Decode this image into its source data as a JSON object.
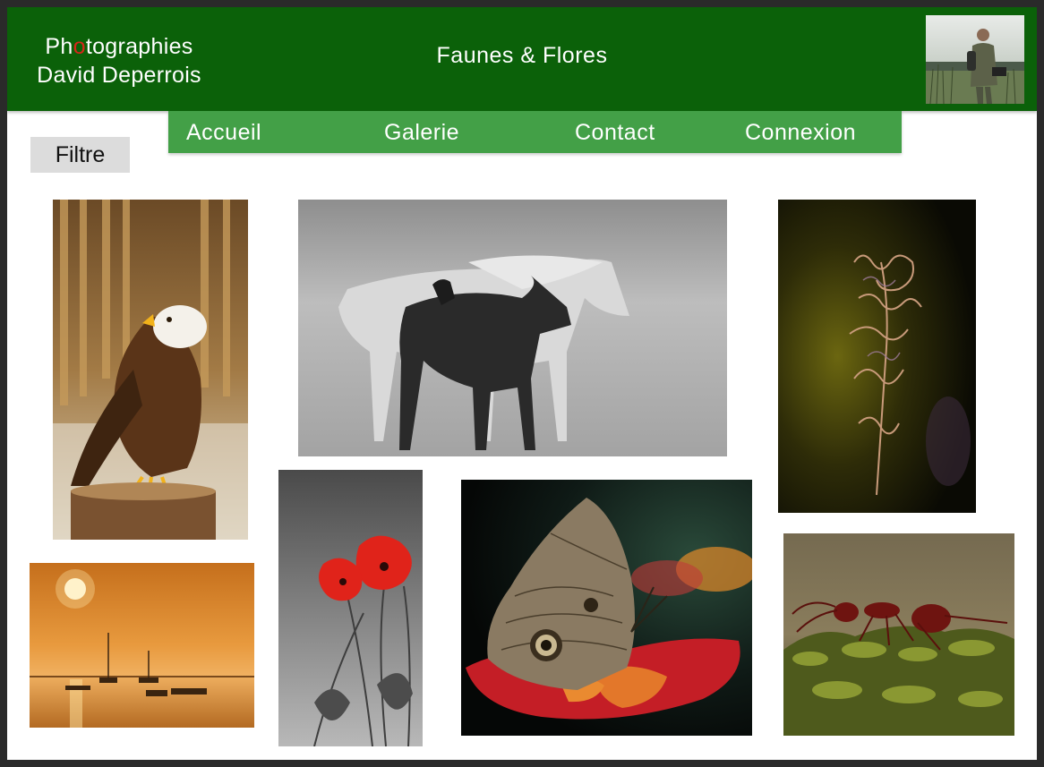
{
  "header": {
    "brand_line1_a": "Ph",
    "brand_line1_accent": "o",
    "brand_line1_b": "tographies",
    "brand_line2": "David Deperrois",
    "site_title": "Faunes & Flores",
    "background_color": "#0b6109",
    "accent_color": "#d7261b"
  },
  "nav": {
    "background_color": "#43a047",
    "items": [
      {
        "label": "Accueil"
      },
      {
        "label": "Galerie"
      },
      {
        "label": "Contact"
      },
      {
        "label": "Connexion"
      }
    ]
  },
  "filter": {
    "label": "Filtre"
  },
  "gallery": {
    "photos": [
      {
        "subject": "bald eagle perched on stump",
        "icon": "eagle-photo"
      },
      {
        "subject": "black and white horse with foal",
        "icon": "horses-photo"
      },
      {
        "subject": "dried fireweed flower spiral",
        "icon": "flower-photo"
      },
      {
        "subject": "sunset over sea with boats",
        "icon": "sunset-photo"
      },
      {
        "subject": "red poppies on grey background",
        "icon": "poppies-photo"
      },
      {
        "subject": "owl butterfly on red dish",
        "icon": "butterfly-photo"
      },
      {
        "subject": "red ant on moss",
        "icon": "ant-photo"
      }
    ]
  }
}
